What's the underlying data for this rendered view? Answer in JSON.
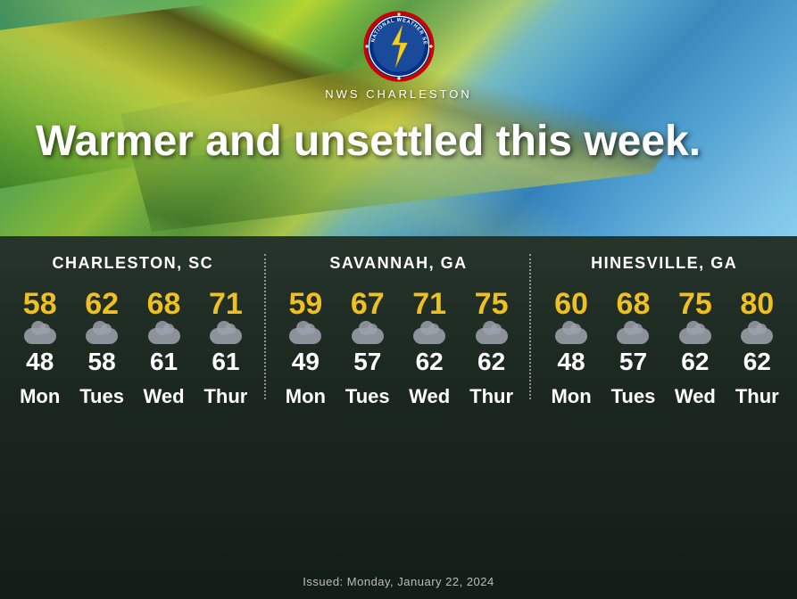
{
  "header": {
    "agency": "NWS CHARLESTON",
    "headline": "Warmer and unsettled this week."
  },
  "cities": [
    {
      "name": "CHARLESTON, SC",
      "days": [
        {
          "label": "Mon",
          "high": "58",
          "low": "48"
        },
        {
          "label": "Tues",
          "high": "62",
          "low": "58"
        },
        {
          "label": "Wed",
          "high": "68",
          "low": "61"
        },
        {
          "label": "Thur",
          "high": "71",
          "low": "61"
        }
      ]
    },
    {
      "name": "SAVANNAH, GA",
      "days": [
        {
          "label": "Mon",
          "high": "59",
          "low": "49"
        },
        {
          "label": "Tues",
          "high": "67",
          "low": "57"
        },
        {
          "label": "Wed",
          "high": "71",
          "low": "62"
        },
        {
          "label": "Thur",
          "high": "75",
          "low": "62"
        }
      ]
    },
    {
      "name": "HINESVILLE, GA",
      "days": [
        {
          "label": "Mon",
          "high": "60",
          "low": "48"
        },
        {
          "label": "Tues",
          "high": "68",
          "low": "57"
        },
        {
          "label": "Wed",
          "high": "75",
          "low": "62"
        },
        {
          "label": "Thur",
          "high": "80",
          "low": "62"
        }
      ]
    }
  ],
  "issued": "Issued: Monday, January 22, 2024"
}
